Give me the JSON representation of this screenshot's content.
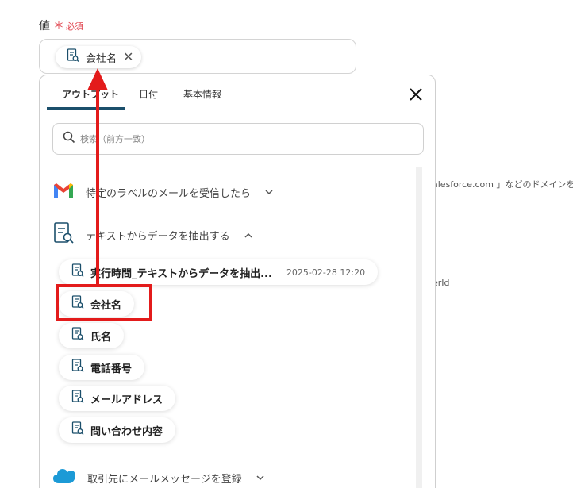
{
  "field": {
    "label": "値",
    "required_mark": "＊",
    "required_text": "必須"
  },
  "value_chip": {
    "label": "会社名",
    "icon": "document-search-icon"
  },
  "background": {
    "hint1": "alesforce.com 」などのドメインを記",
    "hint2": "erId"
  },
  "popup": {
    "tabs": [
      "アウトプット",
      "日付",
      "基本情報"
    ],
    "active_tab": 0,
    "search_placeholder": "検索（前方一致）",
    "sections": [
      {
        "label": "特定のラベルのメールを受信したら",
        "icon": "gmail-icon",
        "expanded": false
      },
      {
        "label": "テキストからデータを抽出する",
        "icon": "document-search-icon",
        "expanded": true
      },
      {
        "label": "取引先にメールメッセージを登録",
        "icon": "salesforce-icon",
        "expanded": false
      }
    ],
    "items": [
      {
        "label": "実行時間_テキストからデータを抽出...",
        "timestamp": "2025-02-28 12:20"
      },
      {
        "label": "会社名",
        "timestamp": ""
      },
      {
        "label": "氏名",
        "timestamp": ""
      },
      {
        "label": "電話番号",
        "timestamp": ""
      },
      {
        "label": "メールアドレス",
        "timestamp": ""
      },
      {
        "label": "問い合わせ内容",
        "timestamp": ""
      }
    ]
  },
  "colors": {
    "accent": "#1b4f6b",
    "annotation_red": "#e31b1b",
    "required": "#e0424c"
  }
}
